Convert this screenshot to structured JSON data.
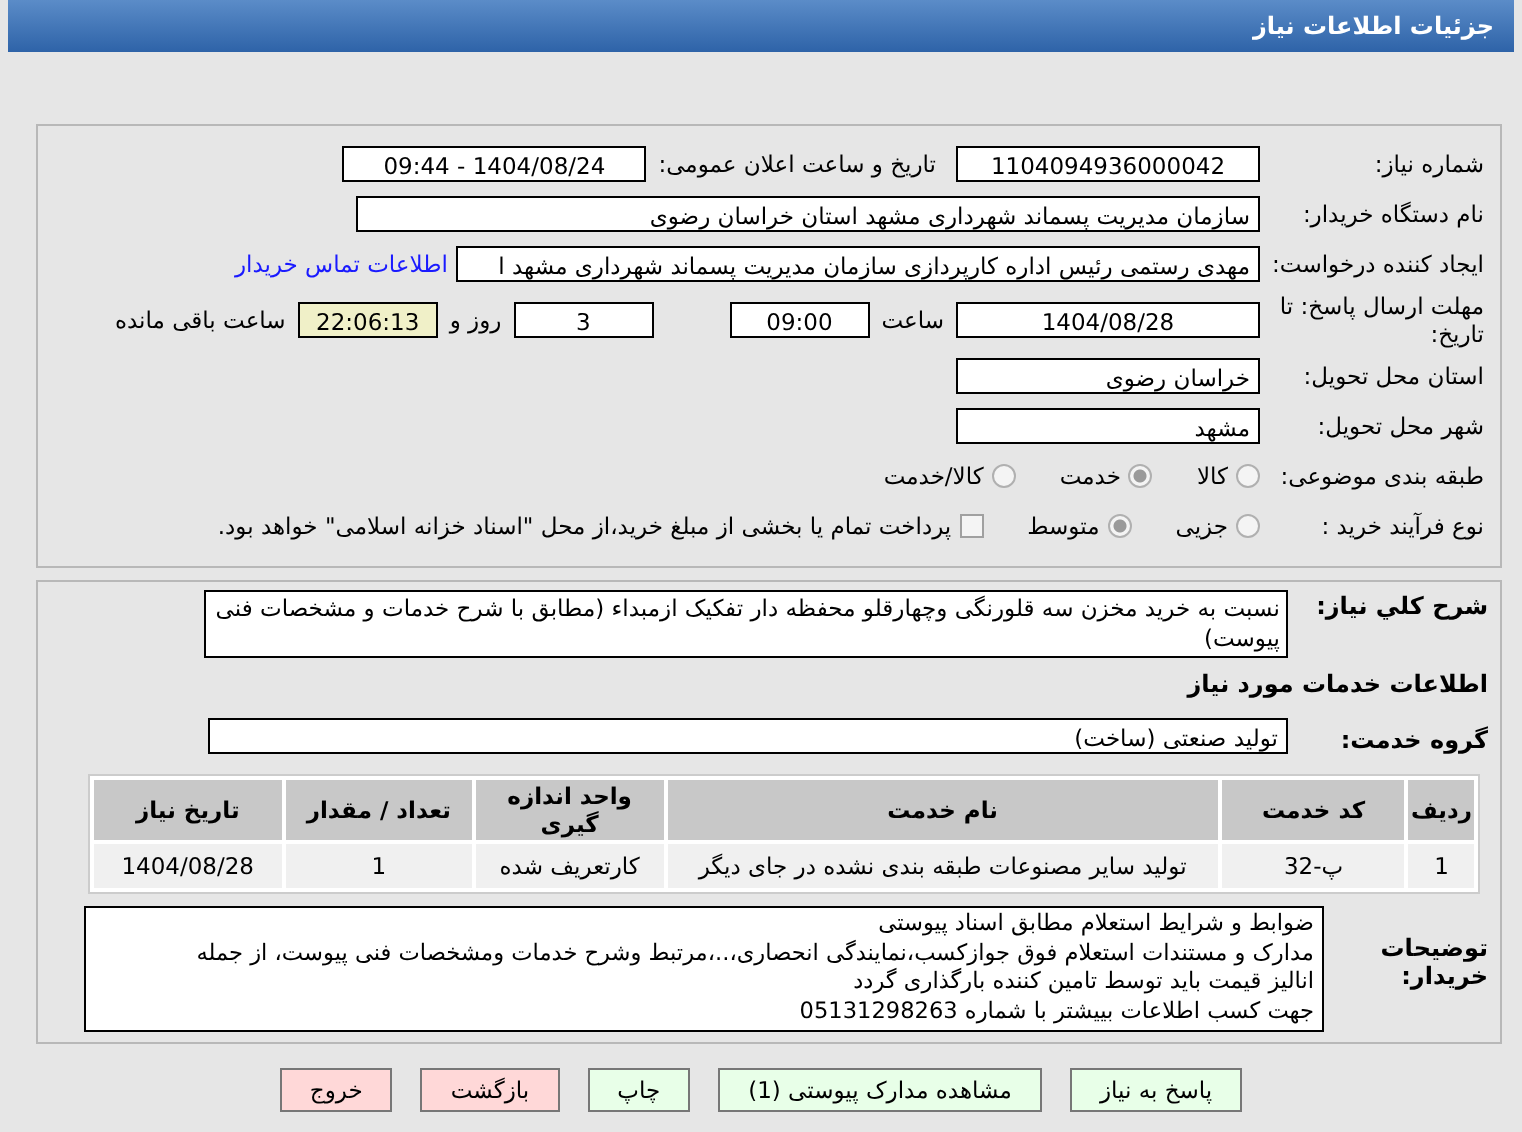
{
  "title": "جزئیات اطلاعات نیاز",
  "need_number": {
    "label": "شماره نیاز:",
    "value": "1104094936000042"
  },
  "announce": {
    "label": "تاریخ و ساعت اعلان عمومی:",
    "value": "1404/08/24 - 09:44"
  },
  "buyer": {
    "label": "نام دستگاه خریدار:",
    "value": "سازمان مدیریت پسماند شهرداری مشهد استان خراسان رضوی"
  },
  "requester": {
    "label": "ایجاد کننده درخواست:",
    "value": "مهدی رستمی رئیس اداره کارپردازی سازمان مدیریت پسماند شهرداری مشهد ا",
    "link": "اطلاعات تماس خریدار"
  },
  "deadline": {
    "label": "مهلت ارسال پاسخ: تا تاریخ:",
    "date": "1404/08/28",
    "time_label": "ساعت",
    "time": "09:00",
    "days": "3",
    "days_label": "روز و",
    "remaining": "22:06:13",
    "remaining_label": "ساعت باقی مانده"
  },
  "province": {
    "label": "استان محل تحویل:",
    "value": "خراسان رضوی"
  },
  "city": {
    "label": "شهر محل تحویل:",
    "value": "مشهد"
  },
  "category": {
    "label": "طبقه بندی موضوعی:",
    "options": [
      {
        "label": "کالا",
        "selected": false
      },
      {
        "label": "خدمت",
        "selected": true
      },
      {
        "label": "کالا/خدمت",
        "selected": false
      }
    ]
  },
  "process": {
    "label": "نوع فرآیند خرید :",
    "options": [
      {
        "label": "جزیی",
        "selected": false
      },
      {
        "label": "متوسط",
        "selected": true
      }
    ],
    "payment": {
      "checked": false,
      "label": "پرداخت تمام یا بخشی از مبلغ خرید،از محل \"اسناد خزانه اسلامی\" خواهد بود."
    }
  },
  "description": {
    "label": "شرح کلي نياز:",
    "value": "نسبت به خرید مخزن سه قلورنگی وچهارقلو محفظه دار تفکیک ازمبداء (مطابق با شرح خدمات و مشخصات فنی پیوست)"
  },
  "services_heading": "اطلاعات خدمات مورد نیاز",
  "service_group": {
    "label": "گروه خدمت:",
    "value": "تولید صنعتی (ساخت)"
  },
  "table": {
    "columns": [
      "ردیف",
      "کد خدمت",
      "نام خدمت",
      "واحد اندازه گیری",
      "تعداد / مقدار",
      "تاریخ نیاز"
    ],
    "rows": [
      [
        "1",
        "پ-32",
        "تولید سایر مصنوعات طبقه بندی نشده در جای دیگر",
        "کارتعریف شده",
        "1",
        "1404/08/28"
      ]
    ]
  },
  "buyer_notes": {
    "label": "توضیحات خریدار:",
    "lines": [
      "ضوابط و شرایط استعلام مطابق اسناد پیوستی",
      "مدارک و مستندات استعلام فوق جوازکسب،نمایندگی انحصاری،..،مرتبط وشرح خدمات ومشخصات فنی پیوست، از جمله",
      "انالیز قیمت باید توسط تامین کننده بارگذاری گردد",
      "جهت کسب اطلاعات بییشتر با شماره 05131298263"
    ]
  },
  "buttons": [
    {
      "label": "پاسخ به نیاز",
      "color": "#e8ffe8"
    },
    {
      "label": "مشاهده مدارک پیوستی (1)",
      "color": "#e8ffe8"
    },
    {
      "label": "چاپ",
      "color": "#e8ffe8"
    },
    {
      "label": "بازگشت",
      "color": "#ffd8d8"
    },
    {
      "label": "خروج",
      "color": "#ffd8d8"
    }
  ]
}
